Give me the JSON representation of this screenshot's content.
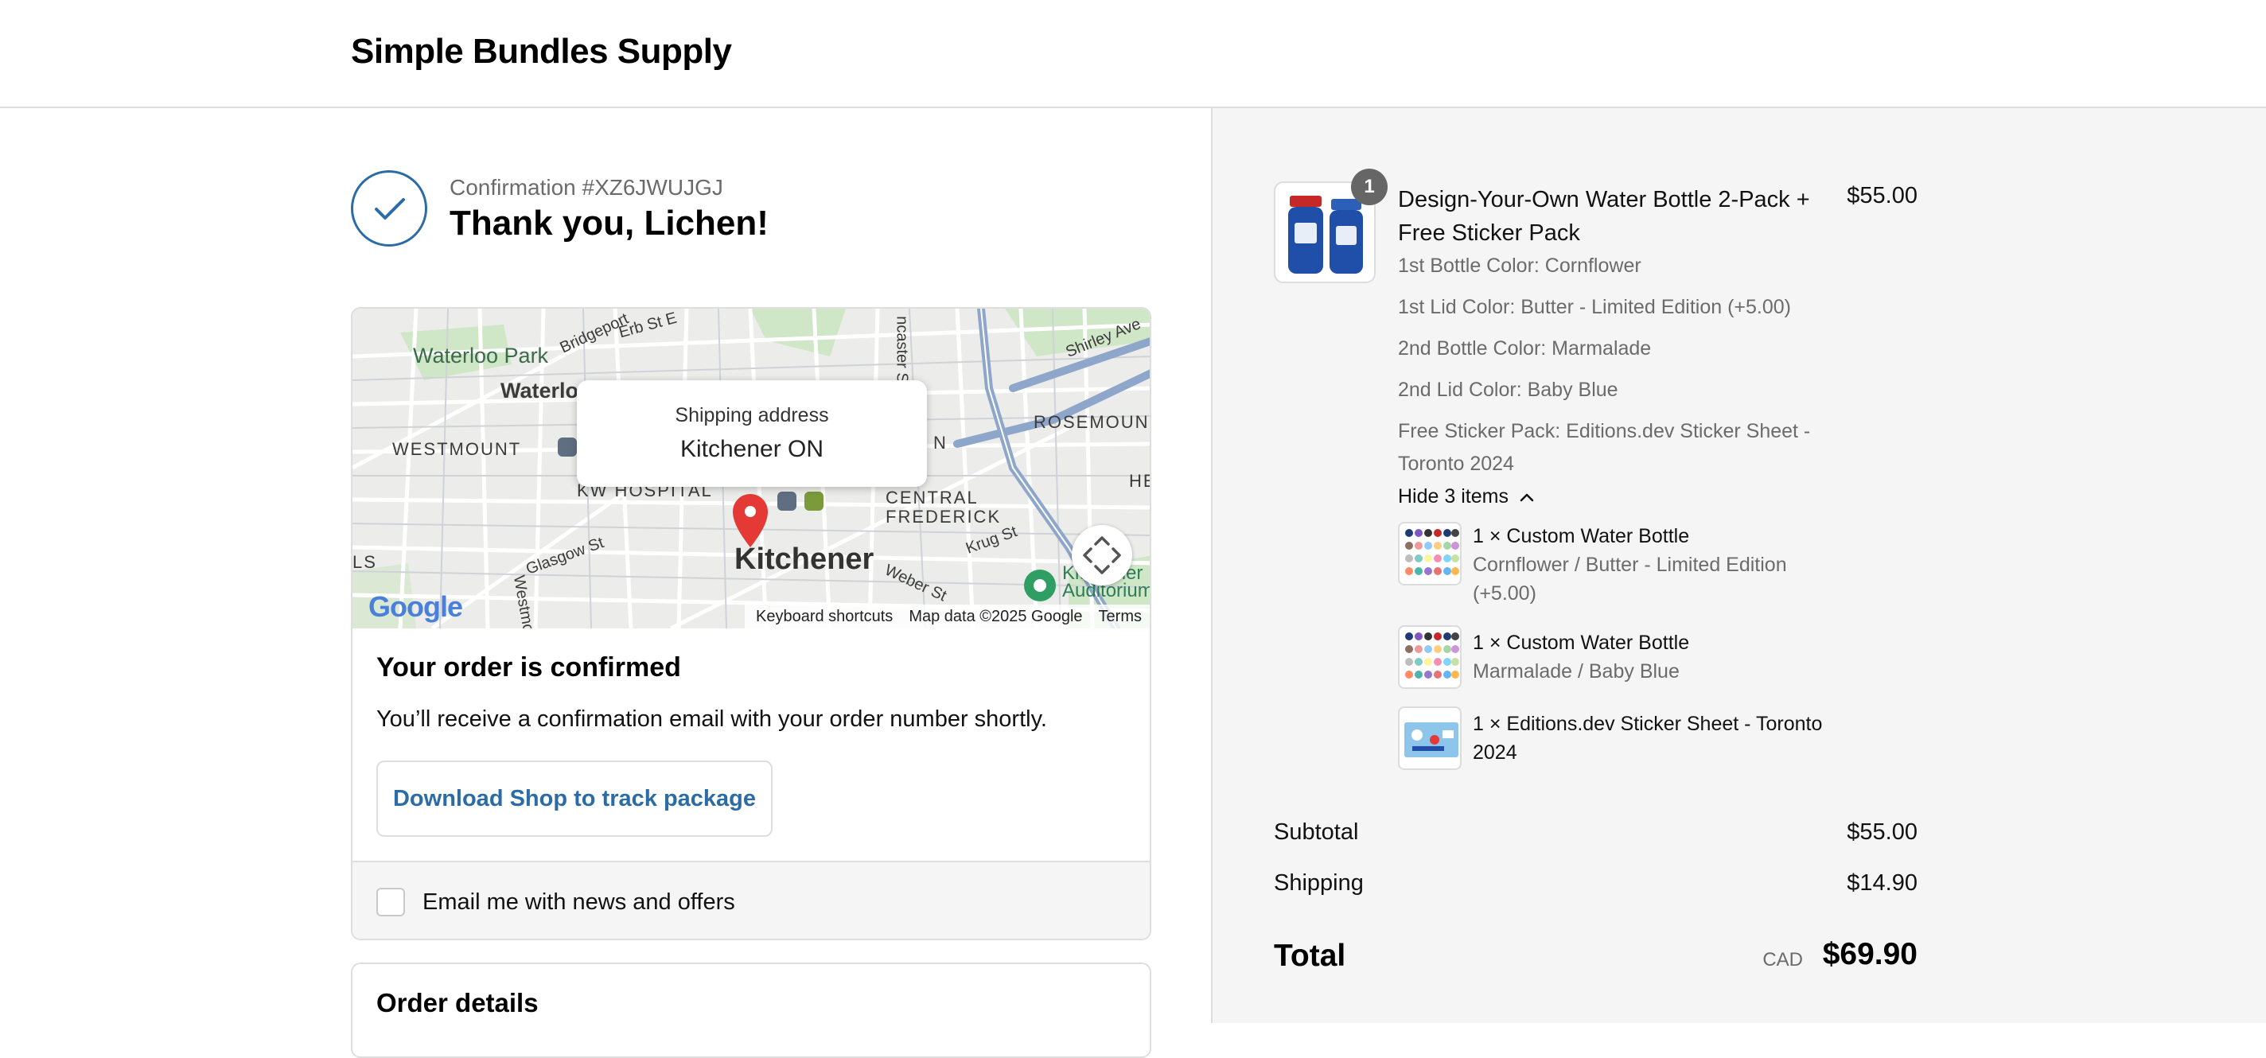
{
  "header": {
    "store_name": "Simple Bundles Supply"
  },
  "confirmation": {
    "number": "Confirmation #XZ6JWUJGJ",
    "thank_you": "Thank you, Lichen!"
  },
  "map": {
    "popup_title": "Shipping address",
    "popup_value": "Kitchener ON",
    "labels": {
      "waterloo_park": "Waterloo Park",
      "waterloo": "Waterlo",
      "westmount": "WESTMOUNT",
      "kw_hospital": "KW HOSPITAL",
      "central_frederick": "CENTRAL\nFREDERICK",
      "rosemount": "ROSEMOUNT",
      "kitchener": "Kitchener",
      "glasgow": "Glasgow St",
      "krug": "Krug St",
      "weber": "Weber St",
      "bridgeport": "Bridgeport",
      "erb": "Erb St E",
      "shirley": "Shirley Ave",
      "lancaster": "ncaster S",
      "auditorium": "Kitchener\nAuditorium",
      "ls": "LS",
      "he": "HE",
      "n": "N",
      "westmo": "Westmo"
    },
    "footer": {
      "keyboard": "Keyboard shortcuts",
      "data": "Map data ©2025 Google",
      "terms": "Terms"
    },
    "google_logo": "Google"
  },
  "order": {
    "confirmed_title": "Your order is confirmed",
    "confirmed_text": "You’ll receive a confirmation email with your order number shortly.",
    "shop_button": "Download Shop to track package",
    "email_label": "Email me with news and offers",
    "details_title": "Order details"
  },
  "summary": {
    "product": {
      "quantity": "1",
      "name": "Design-Your-Own Water Bottle 2-Pack + Free Sticker Pack",
      "price": "$55.00",
      "options": [
        "1st Bottle Color: Cornflower",
        "1st Lid Color: Butter - Limited Edition (+5.00)",
        "2nd Bottle Color: Marmalade",
        "2nd Lid Color: Baby Blue",
        "Free Sticker Pack: Editions.dev Sticker Sheet - Toronto 2024"
      ],
      "hide_items": "Hide 3 items",
      "sub_items": [
        {
          "title": "1 × Custom Water Bottle",
          "desc": "Cornflower / Butter - Limited Edition (+5.00)"
        },
        {
          "title": "1 × Custom Water Bottle",
          "desc": "Marmalade / Baby Blue"
        },
        {
          "title": "1 × Editions.dev Sticker Sheet - Toronto 2024",
          "desc": ""
        }
      ]
    },
    "subtotal_label": "Subtotal",
    "subtotal_value": "$55.00",
    "shipping_label": "Shipping",
    "shipping_value": "$14.90",
    "total_label": "Total",
    "currency": "CAD",
    "total_value": "$69.90"
  },
  "colors": {
    "accent": "#2c6ca6",
    "map_pin": "#e53935",
    "panel_bg": "#f5f5f5"
  }
}
